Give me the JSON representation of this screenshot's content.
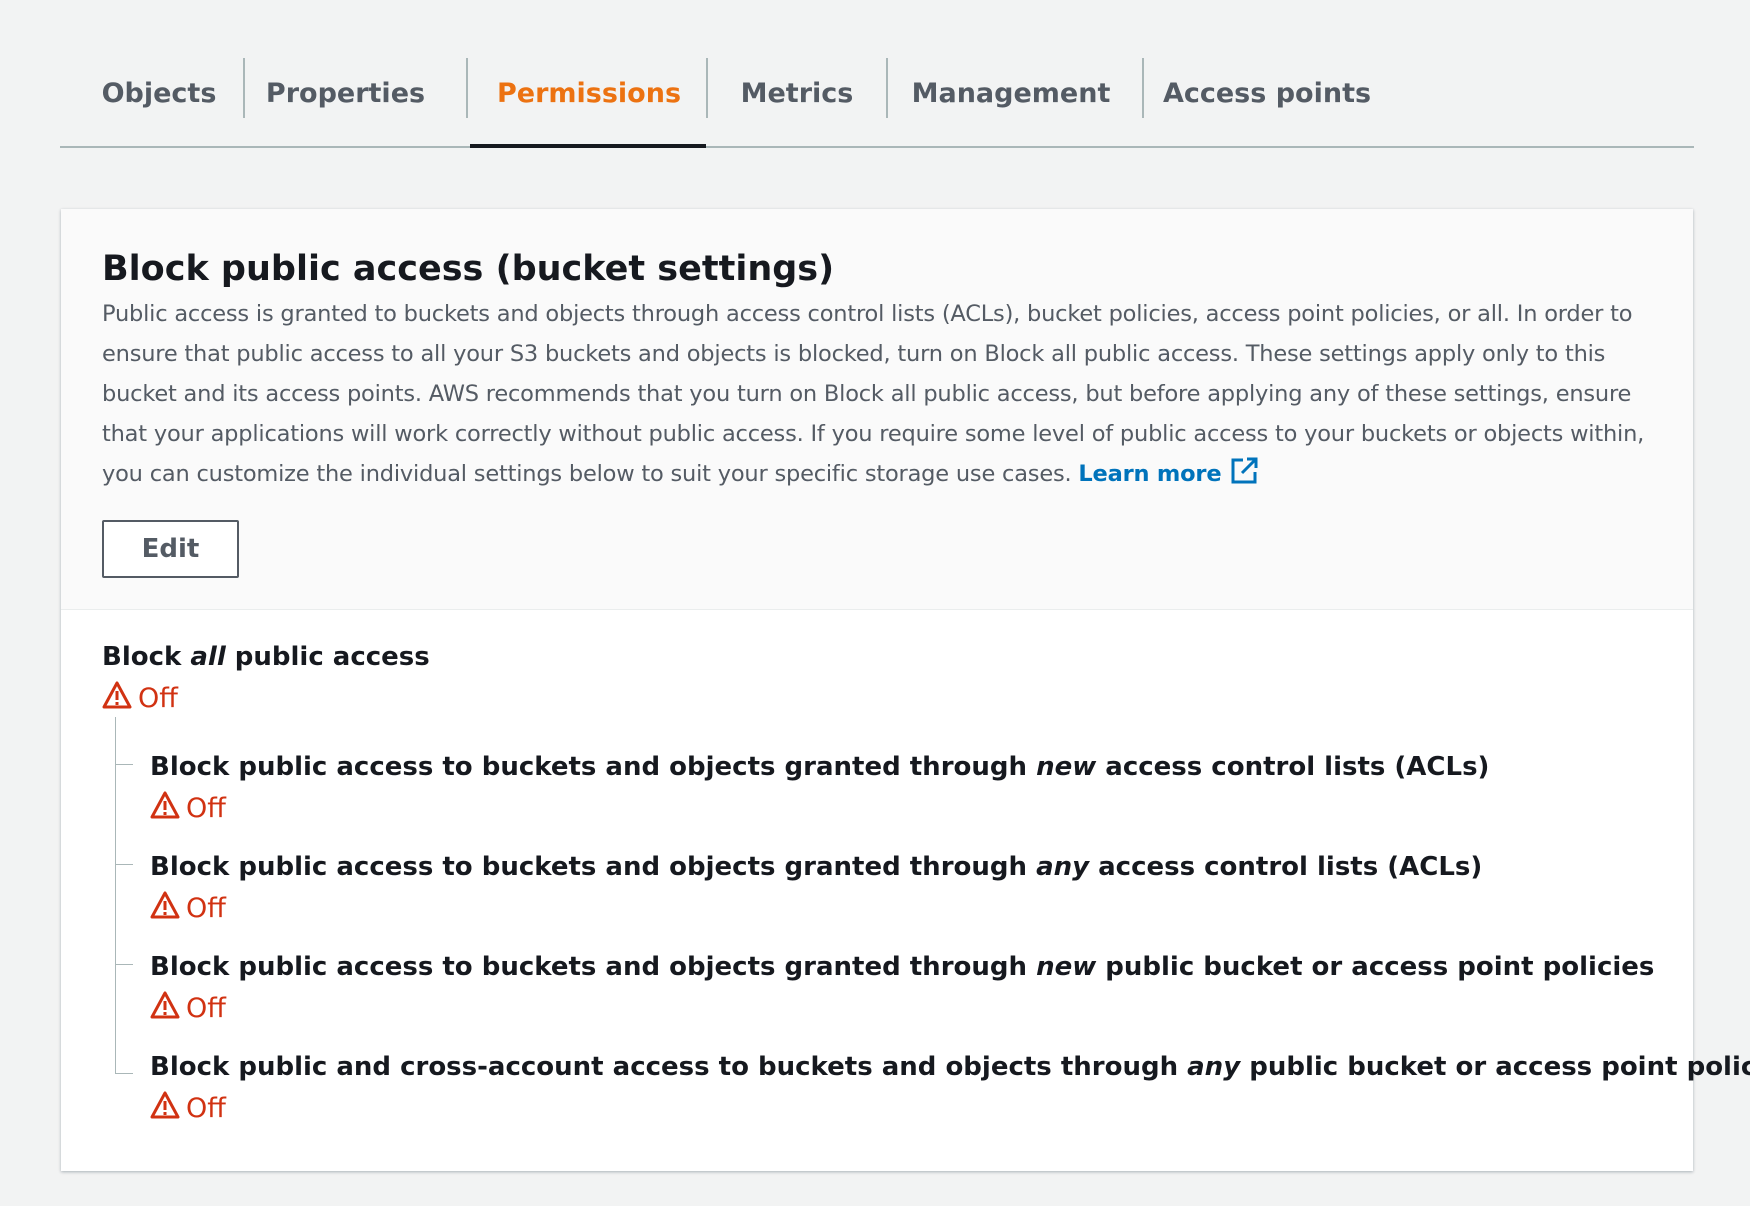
{
  "tabs": [
    {
      "label": "Objects"
    },
    {
      "label": "Properties"
    },
    {
      "label": "Permissions",
      "active": true
    },
    {
      "label": "Metrics"
    },
    {
      "label": "Management"
    },
    {
      "label": "Access points"
    }
  ],
  "panel": {
    "title": "Block public access (bucket settings)",
    "description": "Public access is granted to buckets and objects through access control lists (ACLs), bucket policies, access point policies, or all. In order to ensure that public access to all your S3 buckets and objects is blocked, turn on Block all public access. These settings apply only to this bucket and its access points. AWS recommends that you turn on Block all public access, but before applying any of these settings, ensure that your applications will work correctly without public access. If you require some level of public access to your buckets or objects within, you can customize the individual settings below to suit your specific storage use cases.",
    "learn_more": "Learn more",
    "edit_label": "Edit"
  },
  "block_all": {
    "label_pre": "Block ",
    "label_em": "all",
    "label_post": " public access",
    "status": "Off"
  },
  "sub_settings": [
    {
      "pre": "Block public access to buckets and objects granted through ",
      "em": "new",
      "post": " access control lists (ACLs)",
      "status": "Off"
    },
    {
      "pre": "Block public access to buckets and objects granted through ",
      "em": "any",
      "post": " access control lists (ACLs)",
      "status": "Off"
    },
    {
      "pre": "Block public access to buckets and objects granted through ",
      "em": "new",
      "post": " public bucket or access point policies",
      "status": "Off"
    },
    {
      "pre": "Block public and cross-account access to buckets and objects through ",
      "em": "any",
      "post": " public bucket or access point policies",
      "status": "Off"
    }
  ],
  "colors": {
    "active_tab": "#ec7211",
    "warning": "#d13212",
    "link": "#0073bb"
  },
  "icons": {
    "warning": "warning-icon",
    "external_link": "external-link-icon"
  }
}
